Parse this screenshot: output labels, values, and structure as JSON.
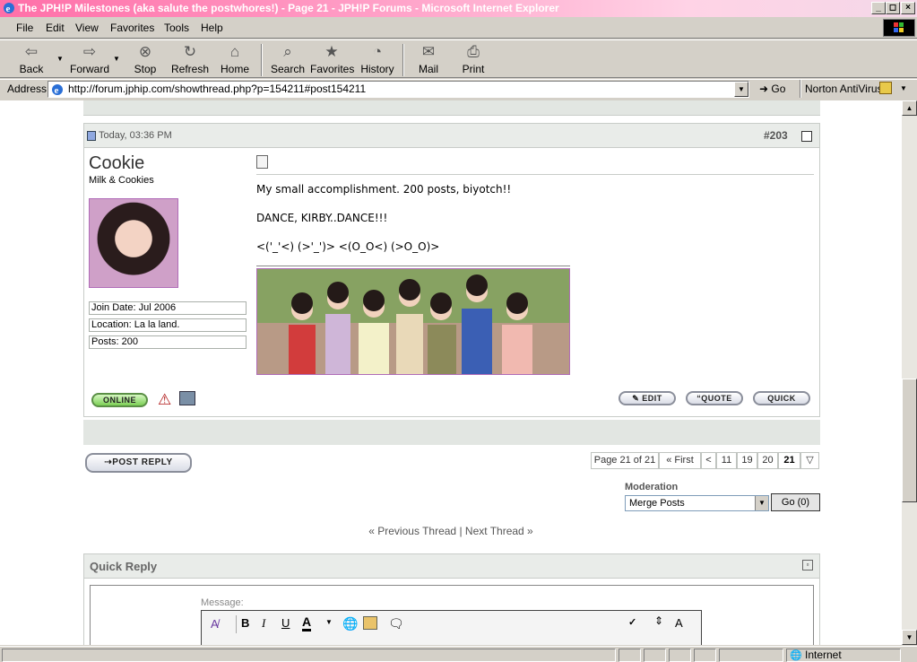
{
  "window": {
    "title": "The JPH!P Milestones (aka salute the postwhores!) - Page 21 - JPH!P Forums - Microsoft Internet Explorer"
  },
  "menu": [
    "File",
    "Edit",
    "View",
    "Favorites",
    "Tools",
    "Help"
  ],
  "toolbar": {
    "back": "Back",
    "forward": "Forward",
    "stop": "Stop",
    "refresh": "Refresh",
    "home": "Home",
    "search": "Search",
    "favorites": "Favorites",
    "history": "History",
    "mail": "Mail",
    "print": "Print"
  },
  "address": {
    "label": "Address",
    "url": "http://forum.jphip.com/showthread.php?p=154211#post154211",
    "go": "Go",
    "norton": "Norton AntiVirus"
  },
  "post": {
    "timestamp": "Today, 03:36 PM",
    "number": "#203",
    "username": "Cookie",
    "usertitle": "Milk & Cookies",
    "join_date": "Join Date: Jul 2006",
    "location": "Location: La la land.",
    "posts": "Posts: 200",
    "line1": "My small accomplishment. 200 posts, biyotch!!",
    "line2": "DANCE, KIRBY..DANCE!!!",
    "line3": "<('_'<) (>'_')> <(O_O<) (>O_O)>",
    "online": "ONLINE",
    "edit": "EDIT",
    "quote": "QUOTE",
    "quick": "QUICK"
  },
  "post_reply": "POST REPLY",
  "pagination": {
    "label": "Page 21 of 21",
    "first": "« First",
    "prev": "<",
    "pages": [
      "11",
      "19",
      "20",
      "21"
    ]
  },
  "moderation": {
    "label": "Moderation",
    "selected": "Merge Posts",
    "go": "Go (0)"
  },
  "thread_nav": {
    "prev": "« Previous Thread",
    "sep": "|",
    "next": "Next Thread »"
  },
  "quick_reply": {
    "title": "Quick Reply",
    "message_label": "Message:"
  },
  "status": {
    "zone": "Internet"
  },
  "colors": {
    "titlebar": "#ff6fa8",
    "accent": "#e9ece9",
    "online": "#9be07a"
  }
}
